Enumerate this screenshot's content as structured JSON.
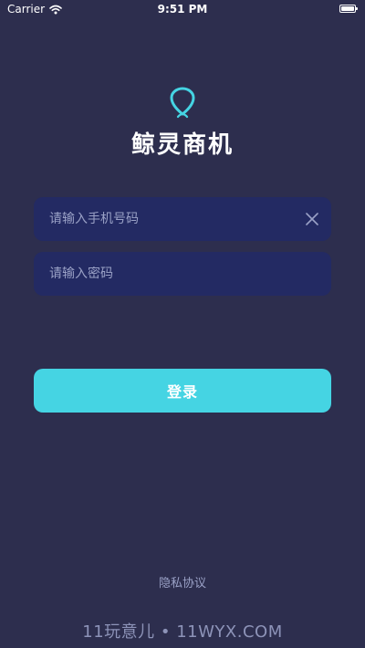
{
  "status_bar": {
    "carrier": "Carrier",
    "time": "9:51 PM",
    "wifi_icon": "wifi-icon",
    "battery_icon": "battery-icon"
  },
  "app": {
    "title": "鲸灵商机",
    "logo_icon": "whale-logo-icon",
    "accent_color": "#45d4e3"
  },
  "form": {
    "phone": {
      "placeholder": "请输入手机号码",
      "value": "",
      "clear_icon": "close-icon"
    },
    "password": {
      "placeholder": "请输入密码",
      "value": ""
    },
    "login_label": "登录"
  },
  "footer": {
    "privacy_label": "隐私协议"
  },
  "watermark": {
    "text": "11玩意儿 • 11WYX.COM"
  }
}
